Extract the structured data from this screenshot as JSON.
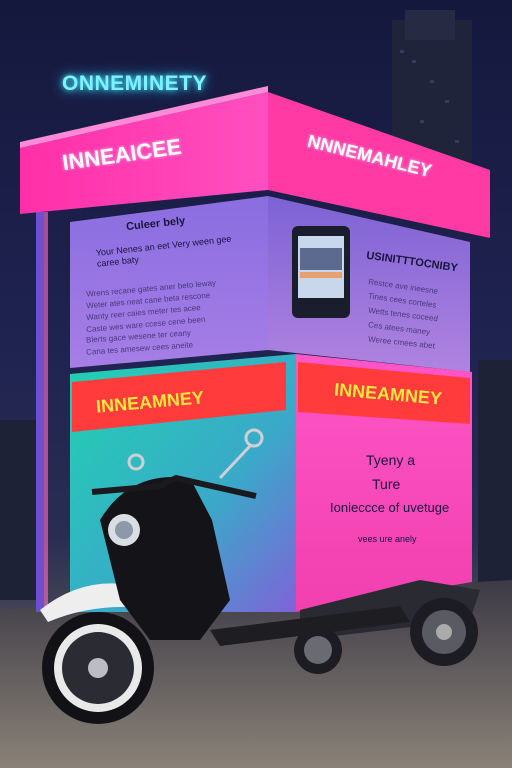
{
  "top_glow_sign": "ONNEMINETY",
  "sign_front_left": "INNEAICEE",
  "sign_front_right": "NNNEMAHLEY",
  "panel_left": {
    "heading": "Culeer bely",
    "subheading": "Your Nenes an eet Very ween gee caree baty",
    "body_lines": [
      "Wrens recane gates aner beto leway",
      "Weter ates neat cane beta rescone",
      "Wanty reer caies meter tes acee",
      "Caste wes ware ccese cene been",
      "Blerts gace wesene ter ceany",
      "Cana tes amesew cees aneite"
    ]
  },
  "panel_right": {
    "heading": "USINITTTOCNIBY",
    "body_lines": [
      "Restce ave ineesne",
      "Tines cees corteles",
      "Wetts tenes coceed",
      "Ces atees maney",
      "Weree cmees abet"
    ]
  },
  "sign_lower_left": "INNEAMNEY",
  "sign_lower_right": "INNEAMNEY",
  "lower_right_panel": {
    "line1": "Tyeny a",
    "line2": "Ture",
    "line3": "Ionieccce of uvetuge",
    "line4": "vees ure anely"
  },
  "colors": {
    "magenta": "#ff2fa8",
    "purple": "#7b57d6",
    "teal": "#22c9a8",
    "red_band": "#ff3b3b",
    "yellow_text": "#ffe640",
    "cyan_glow": "#7ef3ff"
  }
}
